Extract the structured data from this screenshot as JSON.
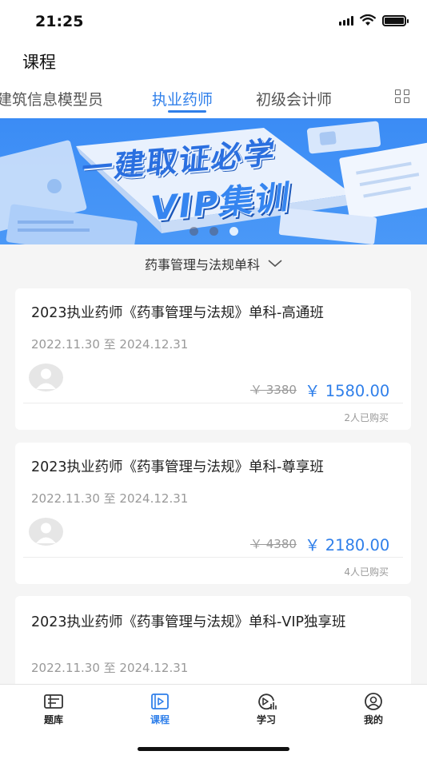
{
  "status_bar": {
    "time": "21:25"
  },
  "header": {
    "title": "课程"
  },
  "category_tabs": [
    {
      "label": "建筑信息模型员",
      "active": false
    },
    {
      "label": "执业药师",
      "active": true
    },
    {
      "label": "初级会计师",
      "active": false
    }
  ],
  "banner": {
    "headline": "一建取证必学",
    "subheadline": "VIP集训",
    "slide_count": 3,
    "active_slide": 2
  },
  "filter": {
    "label": "药事管理与法规单科"
  },
  "courses": [
    {
      "title": "2023执业药师《药事管理与法规》单科-高通班",
      "date_range": "2022.11.30 至 2024.12.31",
      "original_price": "￥ 3380",
      "price": "￥ 1580.00",
      "buyers": "2人已购买"
    },
    {
      "title": "2023执业药师《药事管理与法规》单科-尊享班",
      "date_range": "2022.11.30 至 2024.12.31",
      "original_price": "￥ 4380",
      "price": "￥ 2180.00",
      "buyers": "4人已购买"
    },
    {
      "title": "2023执业药师《药事管理与法规》单科-VIP独享班",
      "date_range": "2022.11.30 至 2024.12.31"
    }
  ],
  "tabbar": [
    {
      "label": "题库",
      "icon": "question-bank-icon",
      "active": false
    },
    {
      "label": "课程",
      "icon": "course-video-icon",
      "active": true
    },
    {
      "label": "学习",
      "icon": "study-play-icon",
      "active": false
    },
    {
      "label": "我的",
      "icon": "profile-icon",
      "active": false
    }
  ],
  "colors": {
    "accent": "#2f7fea",
    "banner_bg": "#3b8cf5"
  }
}
